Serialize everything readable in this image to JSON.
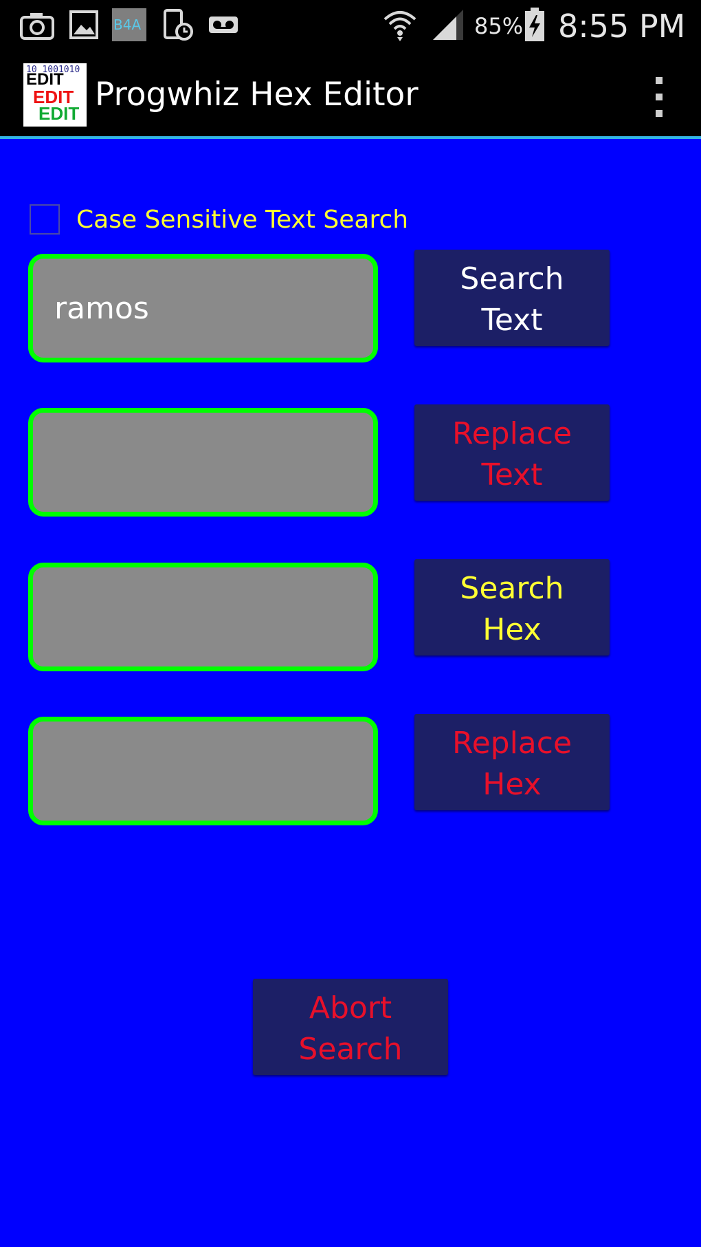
{
  "status_bar": {
    "battery_percent": "85%",
    "time": "8:55 PM",
    "icons": [
      "camera-icon",
      "gallery-icon",
      "b4a-icon",
      "phone-clock-icon",
      "voicemail-icon",
      "wifi-icon",
      "signal-icon",
      "battery-charging-icon"
    ],
    "b4a_label": "B4A"
  },
  "app_bar": {
    "title": "Progwhiz Hex Editor",
    "logo": {
      "words": [
        "EDIT",
        "EDIT",
        "EDIT"
      ],
      "digits": "10 1001010"
    }
  },
  "options": {
    "case_sensitive_label": "Case Sensitive Text Search",
    "case_sensitive_checked": false
  },
  "fields": {
    "search_text_value": "ramos",
    "replace_text_value": "",
    "search_hex_value": "",
    "replace_hex_value": ""
  },
  "buttons": {
    "search_text": "Search\nText",
    "replace_text": "Replace\nText",
    "search_hex": "Search\nHex",
    "replace_hex": "Replace\nHex",
    "abort_search": "Abort\nSearch"
  },
  "colors": {
    "background": "#0000ff",
    "field_border": "#00ff00",
    "field_fill": "#8a8a8a",
    "button_fill": "#1c1f66",
    "accent_line": "#33b5e5"
  }
}
